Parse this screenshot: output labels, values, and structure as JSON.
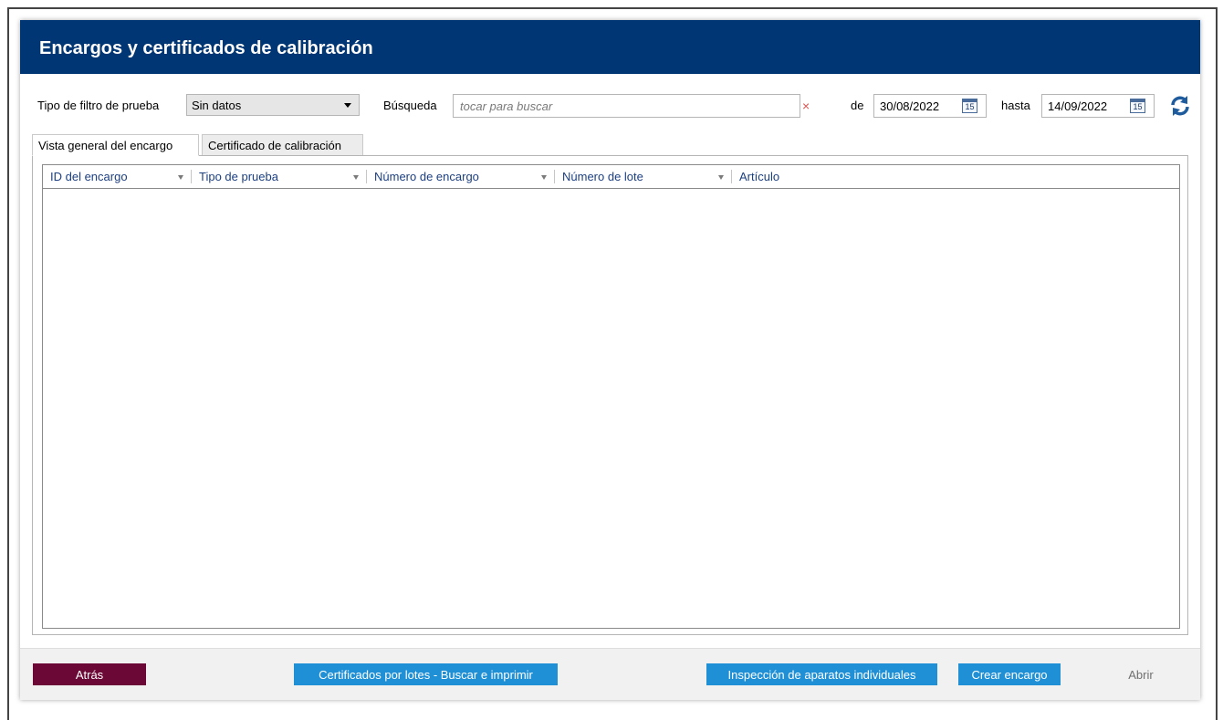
{
  "window": {
    "title": "Encargos y certificados de calibración"
  },
  "filters": {
    "test_filter_label": "Tipo de filtro de prueba",
    "test_filter_value": "Sin datos",
    "search_label": "Búsqueda",
    "search_placeholder": "tocar para buscar",
    "clear_symbol": "×",
    "from_label": "de",
    "from_date": "30/08/2022",
    "to_label": "hasta",
    "to_date": "14/09/2022",
    "calendar_day": "15"
  },
  "tabs": [
    {
      "label": "Vista general del encargo",
      "active": true
    },
    {
      "label": "Certificado de calibración",
      "active": false
    }
  ],
  "grid": {
    "columns": [
      "ID del encargo",
      "Tipo de prueba",
      "Número de encargo",
      "Número de lote",
      "Artículo"
    ],
    "rows": []
  },
  "footer": {
    "back": "Atrás",
    "batch_certificates": "Certificados por lotes - Buscar e imprimir",
    "single_inspection": "Inspección de aparatos individuales",
    "create_order": "Crear encargo",
    "open": "Abrir"
  },
  "colors": {
    "title_bar": "#003673",
    "back_button": "#6b0835",
    "action_button": "#1f8fd6",
    "column_header_text": "#1c3f80",
    "refresh_icon": "#1f5c9e",
    "clear_icon": "#d9534f"
  },
  "icons": {
    "dropdown": "chevron-down-icon",
    "clear": "close-icon",
    "calendar": "calendar-icon",
    "refresh": "refresh-icon",
    "column_filter": "filter-arrow-icon"
  }
}
